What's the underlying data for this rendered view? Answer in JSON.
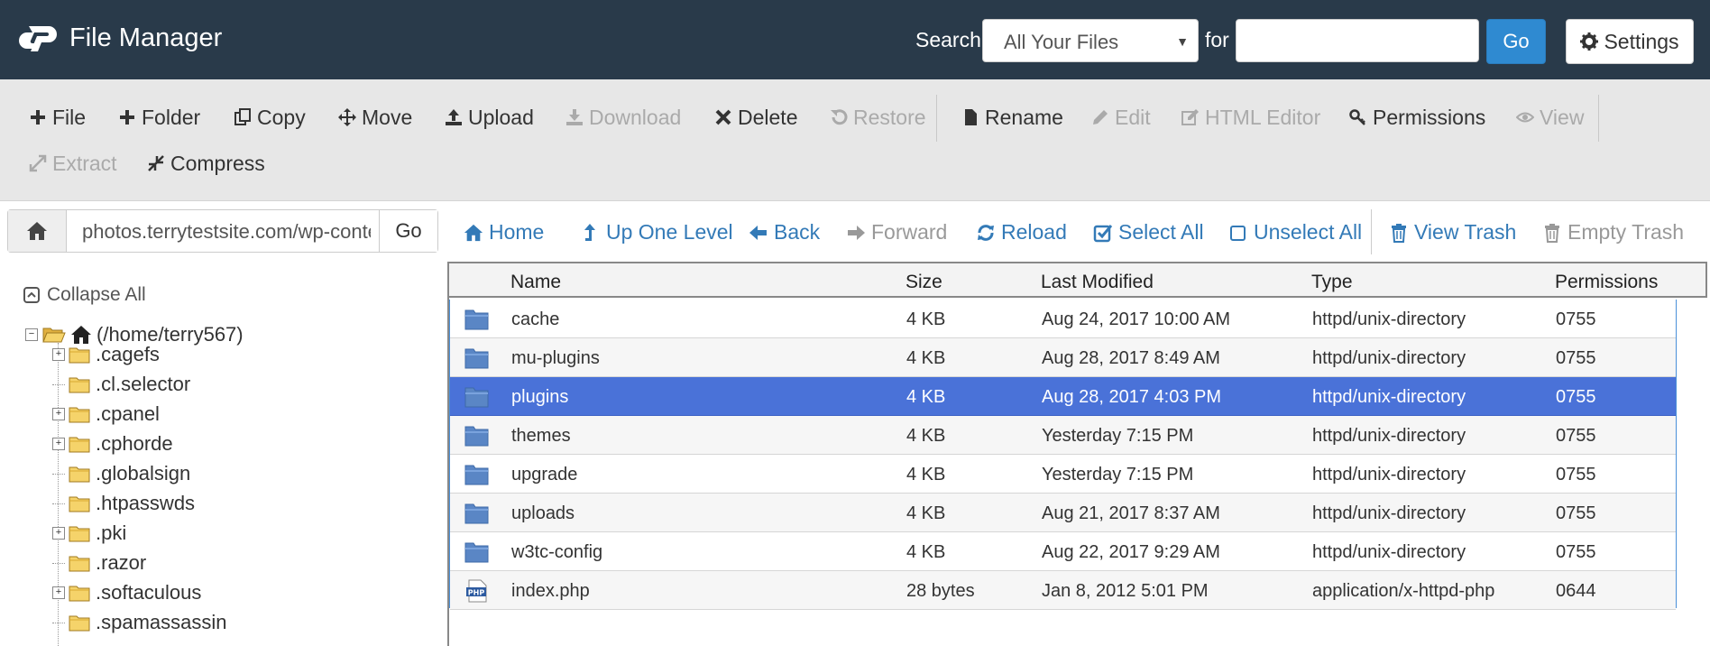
{
  "header": {
    "app_title": "File Manager",
    "search_label": "Search",
    "scope_selected": "All Your Files",
    "for_label": "for",
    "search_value": "",
    "go_label": "Go",
    "settings_label": "Settings"
  },
  "toolbar": {
    "file": "File",
    "folder": "Folder",
    "copy": "Copy",
    "move": "Move",
    "upload": "Upload",
    "download": "Download",
    "delete": "Delete",
    "restore": "Restore",
    "rename": "Rename",
    "edit": "Edit",
    "html_editor": "HTML Editor",
    "permissions": "Permissions",
    "view": "View",
    "extract": "Extract",
    "compress": "Compress"
  },
  "pathbar": {
    "path": "photos.terrytestsite.com/wp-content",
    "go_label": "Go"
  },
  "nav": {
    "home": "Home",
    "up_one_level": "Up One Level",
    "back": "Back",
    "forward": "Forward",
    "reload": "Reload",
    "select_all": "Select All",
    "unselect_all": "Unselect All",
    "view_trash": "View Trash",
    "empty_trash": "Empty Trash"
  },
  "tree": {
    "collapse_all": "Collapse All",
    "root": "(/home/terry567)",
    "items": [
      {
        "label": ".cagefs",
        "expandable": true
      },
      {
        "label": ".cl.selector",
        "expandable": false
      },
      {
        "label": ".cpanel",
        "expandable": true
      },
      {
        "label": ".cphorde",
        "expandable": true
      },
      {
        "label": ".globalsign",
        "expandable": false
      },
      {
        "label": ".htpasswds",
        "expandable": false
      },
      {
        "label": ".pki",
        "expandable": true
      },
      {
        "label": ".razor",
        "expandable": false
      },
      {
        "label": ".softaculous",
        "expandable": true
      },
      {
        "label": ".spamassassin",
        "expandable": false
      }
    ]
  },
  "table": {
    "columns": [
      "Name",
      "Size",
      "Last Modified",
      "Type",
      "Permissions"
    ],
    "rows": [
      {
        "icon": "folder-icon",
        "name": "cache",
        "size": "4 KB",
        "modified": "Aug 24, 2017 10:00 AM",
        "type": "httpd/unix-directory",
        "perms": "0755"
      },
      {
        "icon": "folder-icon",
        "name": "mu-plugins",
        "size": "4 KB",
        "modified": "Aug 28, 2017 8:49 AM",
        "type": "httpd/unix-directory",
        "perms": "0755"
      },
      {
        "icon": "folder-icon",
        "name": "plugins",
        "size": "4 KB",
        "modified": "Aug 28, 2017 4:03 PM",
        "type": "httpd/unix-directory",
        "perms": "0755",
        "selected": true
      },
      {
        "icon": "folder-icon",
        "name": "themes",
        "size": "4 KB",
        "modified": "Yesterday 7:15 PM",
        "type": "httpd/unix-directory",
        "perms": "0755"
      },
      {
        "icon": "folder-icon",
        "name": "upgrade",
        "size": "4 KB",
        "modified": "Yesterday 7:15 PM",
        "type": "httpd/unix-directory",
        "perms": "0755"
      },
      {
        "icon": "folder-icon",
        "name": "uploads",
        "size": "4 KB",
        "modified": "Aug 21, 2017 8:37 AM",
        "type": "httpd/unix-directory",
        "perms": "0755"
      },
      {
        "icon": "folder-icon",
        "name": "w3tc-config",
        "size": "4 KB",
        "modified": "Aug 22, 2017 9:29 AM",
        "type": "httpd/unix-directory",
        "perms": "0755"
      },
      {
        "icon": "php-file-icon",
        "name": "index.php",
        "size": "28 bytes",
        "modified": "Jan 8, 2012 5:01 PM",
        "type": "application/x-httpd-php",
        "perms": "0644"
      }
    ]
  },
  "colors": {
    "header_bg": "#293a4a",
    "accent": "#2f8ad1",
    "link": "#337ab7",
    "selected_row": "#4a72d8"
  }
}
